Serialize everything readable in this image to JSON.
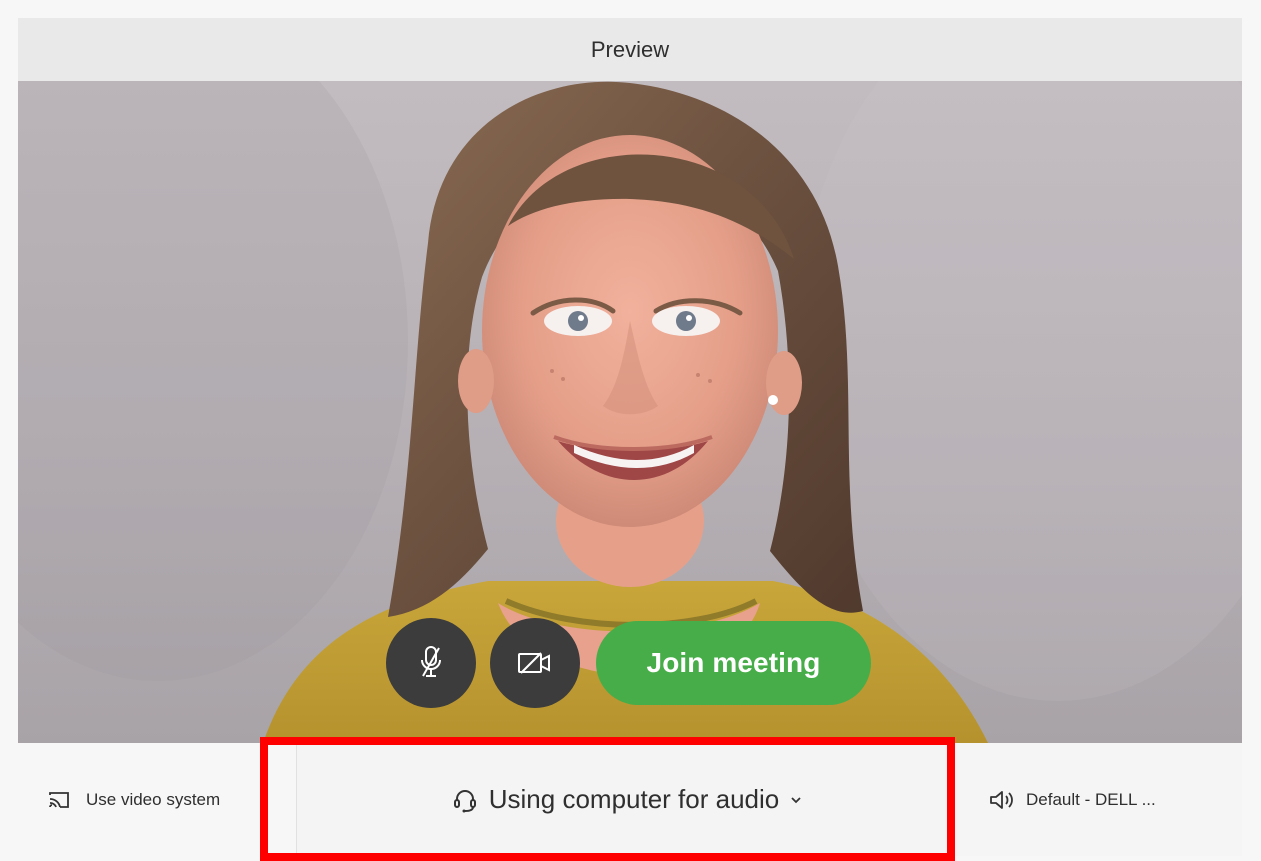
{
  "header": {
    "title": "Preview"
  },
  "controls": {
    "join_label": "Join meeting"
  },
  "bottom": {
    "left_label": "Use video system",
    "audio_label": "Using computer for audio",
    "speaker_label": "Default - DELL ..."
  },
  "colors": {
    "join_green": "#47ad49",
    "highlight_red": "#ff0000",
    "control_dark": "#3c3c3c"
  }
}
